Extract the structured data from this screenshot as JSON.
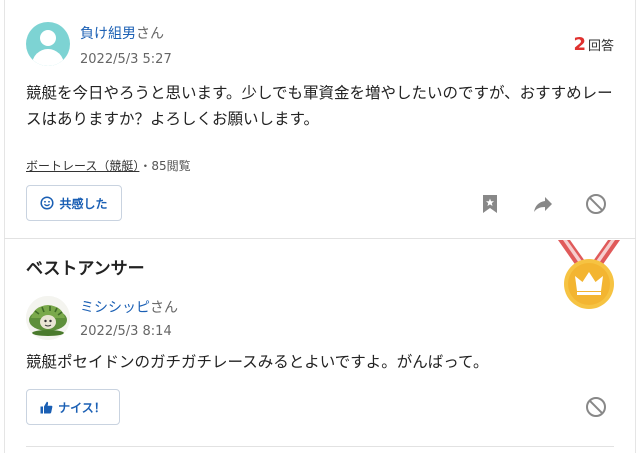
{
  "question": {
    "user": {
      "name": "負け組男",
      "suffix": "さん"
    },
    "date": "2022/5/3 5:27",
    "answer_count": "2",
    "answer_count_label": "回答",
    "body": "競艇を今日やろうと思います。少しでも軍資金を増やしたいのですが、おすすめレースはありますか？よろしくお願いします。",
    "category": "ボートレース（競艇）",
    "views": "・85閲覧",
    "empathy_button": "共感した",
    "icons": [
      "bookmark-icon",
      "share-icon",
      "block-icon"
    ]
  },
  "best_answer": {
    "title": "ベストアンサー",
    "user": {
      "name": "ミシシッピ",
      "suffix": "さん"
    },
    "date": "2022/5/3 8:14",
    "body": "競艇ポセイドンのガチガチレースみるとよいですよ。がんばって。",
    "nice_button": "ナイス！",
    "icons": [
      "medal-icon",
      "block-icon"
    ]
  },
  "colors": {
    "link": "#1a5fb4",
    "answer_count": "#e0312f",
    "medal": "#f6c342",
    "ribbon": "#e05a5a"
  }
}
